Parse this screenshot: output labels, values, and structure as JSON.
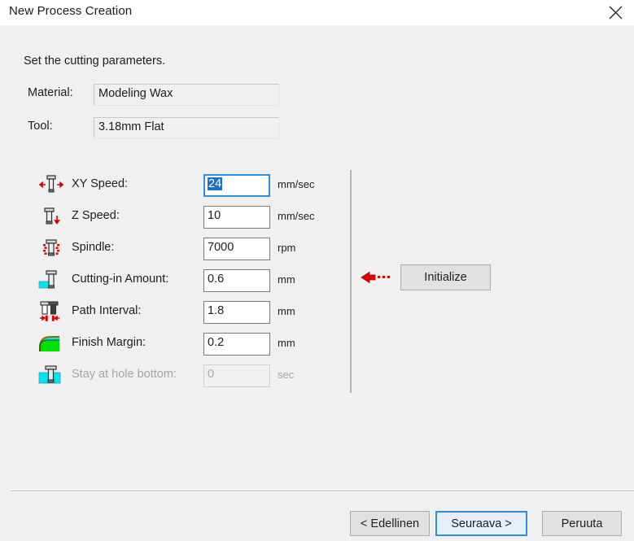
{
  "window": {
    "title": "New Process Creation",
    "close_icon": "close-icon"
  },
  "instruction": "Set the cutting parameters.",
  "info_fields": [
    {
      "label": "Material:",
      "value": "Modeling Wax",
      "icon": ""
    },
    {
      "label": "Tool:",
      "value": "3.18mm Flat",
      "icon": ""
    }
  ],
  "parameters": [
    {
      "icon": "tool-xy-arrows-icon",
      "label": "XY Speed:",
      "value": "24",
      "unit": "mm/sec",
      "focused": true,
      "disabled": false
    },
    {
      "icon": "tool-down-arrow-icon",
      "label": "Z Speed:",
      "value": "10",
      "unit": "mm/sec",
      "focused": false,
      "disabled": false
    },
    {
      "icon": "tool-spindle-rotation-icon",
      "label": "Spindle:",
      "value": "7000",
      "unit": "rpm",
      "focused": false,
      "disabled": false
    },
    {
      "icon": "tool-cutting-depth-icon",
      "label": "Cutting-in Amount:",
      "value": "0.6",
      "unit": "mm",
      "focused": false,
      "disabled": false
    },
    {
      "icon": "tool-path-interval-icon",
      "label": "Path Interval:",
      "value": "1.8",
      "unit": "mm",
      "focused": false,
      "disabled": false
    },
    {
      "icon": "finish-margin-curve-icon",
      "label": "Finish Margin:",
      "value": "0.2",
      "unit": "mm",
      "focused": false,
      "disabled": false
    },
    {
      "icon": "tool-hole-bottom-icon",
      "label": "Stay at hole bottom:",
      "value": "0",
      "unit": "sec",
      "focused": false,
      "disabled": true
    }
  ],
  "initialize": {
    "label": "Initialize",
    "pointer_icon": "red-left-arrow-icon"
  },
  "footer": {
    "back_label": "< Edellinen",
    "next_label": "Seuraava >",
    "cancel_label": "Peruuta"
  },
  "colors": {
    "dialog_bg": "#f0f0f0",
    "titlebar_bg": "#ffffff",
    "focus_blue": "#2a8fe0",
    "selection_blue": "#1c71c4",
    "accent_red": "#e00000",
    "icon_cyan": "#00e5f0",
    "icon_green": "#00e000"
  }
}
